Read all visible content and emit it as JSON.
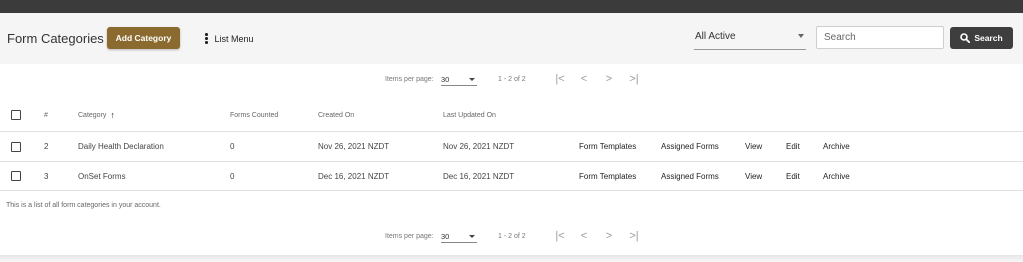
{
  "header": {
    "title": "Form Categories",
    "add_label": "Add Category",
    "list_menu_label": "List Menu",
    "filter_value": "All Active",
    "search_placeholder": "Search",
    "search_label": "Search"
  },
  "paginator": {
    "items_per_page_label": "Items per page:",
    "page_size": "30",
    "range": "1 - 2 of 2"
  },
  "table": {
    "columns": {
      "num": "#",
      "category": "Category",
      "forms_counted": "Forms Counted",
      "created_on": "Created On",
      "last_updated_on": "Last Updated On"
    },
    "sort_icon": "arrow-upward-icon",
    "rows": [
      {
        "num": "2",
        "category": "Daily Health Declaration",
        "forms_counted": "0",
        "created_on": "Nov 26, 2021 NZDT",
        "last_updated_on": "Nov 26, 2021 NZDT"
      },
      {
        "num": "3",
        "category": "OnSet Forms",
        "forms_counted": "0",
        "created_on": "Dec 16, 2021 NZDT",
        "last_updated_on": "Dec 16, 2021 NZDT"
      }
    ],
    "actions": [
      "Form Templates",
      "Assigned Forms",
      "View",
      "Edit",
      "Archive"
    ]
  },
  "footnote": "This is a list of all form categories in your account.",
  "colors": {
    "accent_button": "#8a6a2f",
    "search_button": "#3e3e3e",
    "topbar": "#3b3b3b"
  }
}
